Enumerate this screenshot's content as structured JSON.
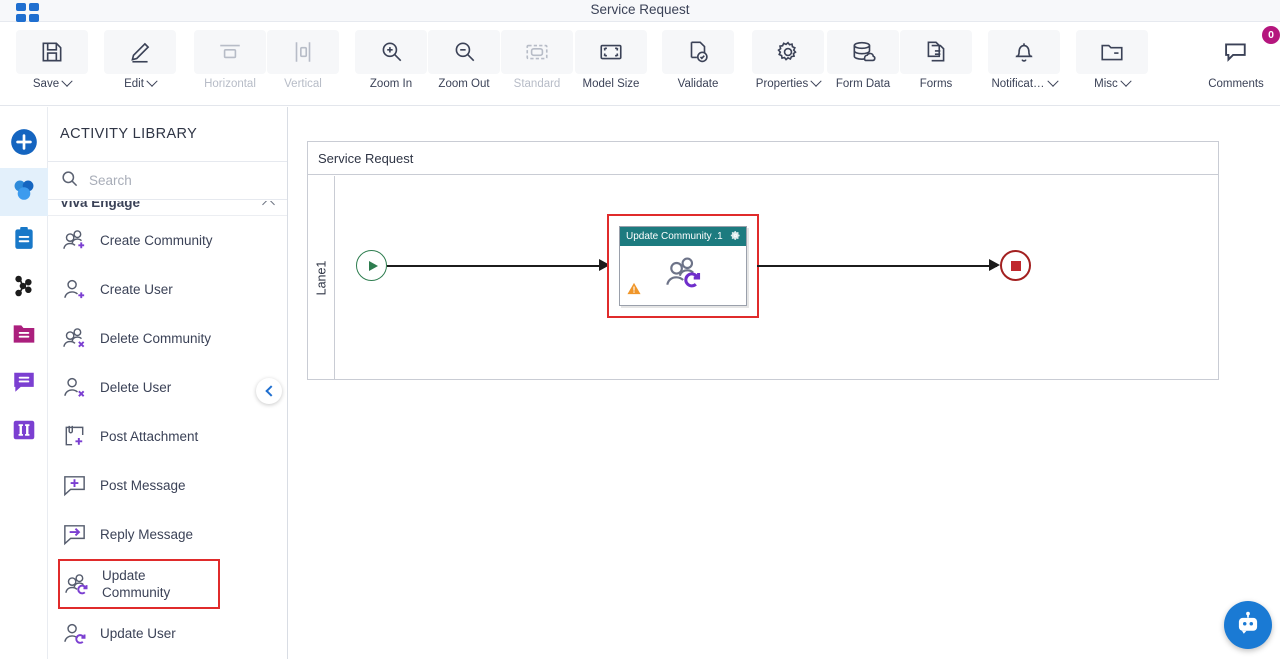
{
  "window": {
    "title": "Service Request",
    "app_grid_icon": "app-grid-icon"
  },
  "toolbar": {
    "items": [
      {
        "label": "Save",
        "icon": "save-icon",
        "caret": true,
        "disabled": false
      },
      {
        "label": "Edit",
        "icon": "pencil-icon",
        "caret": true,
        "disabled": false
      },
      {
        "label": "Horizontal",
        "icon": "horizontal-layout-icon",
        "caret": false,
        "disabled": true
      },
      {
        "label": "Vertical",
        "icon": "vertical-layout-icon",
        "caret": false,
        "disabled": true
      },
      {
        "label": "Zoom In",
        "icon": "zoom-in-icon",
        "caret": false,
        "disabled": false
      },
      {
        "label": "Zoom Out",
        "icon": "zoom-out-icon",
        "caret": false,
        "disabled": false
      },
      {
        "label": "Standard",
        "icon": "standard-size-icon",
        "caret": false,
        "disabled": true
      },
      {
        "label": "Model Size",
        "icon": "model-size-icon",
        "caret": false,
        "disabled": false
      },
      {
        "label": "Validate",
        "icon": "validate-icon",
        "caret": false,
        "disabled": false
      },
      {
        "label": "Properties",
        "icon": "gear-icon",
        "caret": true,
        "disabled": false
      },
      {
        "label": "Form Data",
        "icon": "database-icon",
        "caret": false,
        "disabled": false
      },
      {
        "label": "Forms",
        "icon": "forms-icon",
        "caret": false,
        "disabled": false
      },
      {
        "label": "Notificat…",
        "icon": "bell-icon",
        "caret": true,
        "disabled": false
      },
      {
        "label": "Misc",
        "icon": "folder-icon",
        "caret": true,
        "disabled": false
      }
    ],
    "comments": {
      "label": "Comments",
      "icon": "comment-icon",
      "count": "0",
      "badge_color": "#b5167e"
    }
  },
  "rail": {
    "items": [
      {
        "name": "add-icon",
        "selected": false
      },
      {
        "name": "community-icon",
        "selected": true
      },
      {
        "name": "clipboard-icon",
        "selected": false
      },
      {
        "name": "network-icon",
        "selected": false
      },
      {
        "name": "folder-icon",
        "selected": false
      },
      {
        "name": "message-icon",
        "selected": false
      },
      {
        "name": "columns-icon",
        "selected": false
      }
    ]
  },
  "panel": {
    "title": "ACTIVITY LIBRARY",
    "search": {
      "value": "",
      "placeholder": "Search",
      "icon": "search-icon"
    },
    "category": {
      "label": "Viva Engage",
      "collapsed": false
    },
    "activities": [
      {
        "label": "Create Community",
        "icon": "create-community-icon",
        "highlighted": false
      },
      {
        "label": "Create User",
        "icon": "create-user-icon",
        "highlighted": false
      },
      {
        "label": "Delete Community",
        "icon": "delete-community-icon",
        "highlighted": false
      },
      {
        "label": "Delete User",
        "icon": "delete-user-icon",
        "highlighted": false
      },
      {
        "label": "Post Attachment",
        "icon": "post-attachment-icon",
        "highlighted": false
      },
      {
        "label": "Post Message",
        "icon": "post-message-icon",
        "highlighted": false
      },
      {
        "label": "Reply Message",
        "icon": "reply-message-icon",
        "highlighted": false
      },
      {
        "label": "Update Community",
        "icon": "update-community-icon",
        "highlighted": true
      },
      {
        "label": "Update User",
        "icon": "update-user-icon",
        "highlighted": false
      }
    ],
    "collapse_handle": "chevron-left-icon"
  },
  "canvas": {
    "pool_title": "Service Request",
    "lane_label": "Lane1",
    "start_node": {
      "name": "start-event",
      "color": "#2e7d4f"
    },
    "end_node": {
      "name": "end-event",
      "color": "#a32020"
    },
    "task": {
      "title": "Update Community .1",
      "header_color": "#1d7b7f",
      "selection_color": "#e02b2b",
      "gear_icon": "gear-icon",
      "warning_icon": "warning-icon",
      "body_icon": "update-community-icon"
    }
  },
  "assistant": {
    "icon": "robot-icon",
    "color": "#1a7ad4"
  }
}
